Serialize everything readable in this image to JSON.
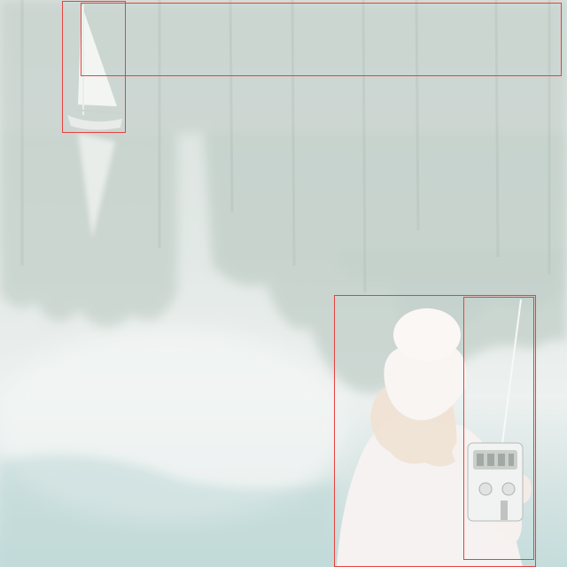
{
  "scene": {
    "type": "photo",
    "colors": {
      "water_light": "#e2e8e5",
      "water_teal": "#a9cbcb",
      "tree_reflection": "#8fa69c",
      "sail": "#f1f3f1",
      "person_clothes": "#f4ecea",
      "hair": "#ead6c2",
      "annotation_box": "#e8413e"
    }
  },
  "annotations": [
    {
      "name": "sailboat"
    },
    {
      "name": "reflection"
    },
    {
      "name": "person"
    },
    {
      "name": "remote-control"
    }
  ]
}
